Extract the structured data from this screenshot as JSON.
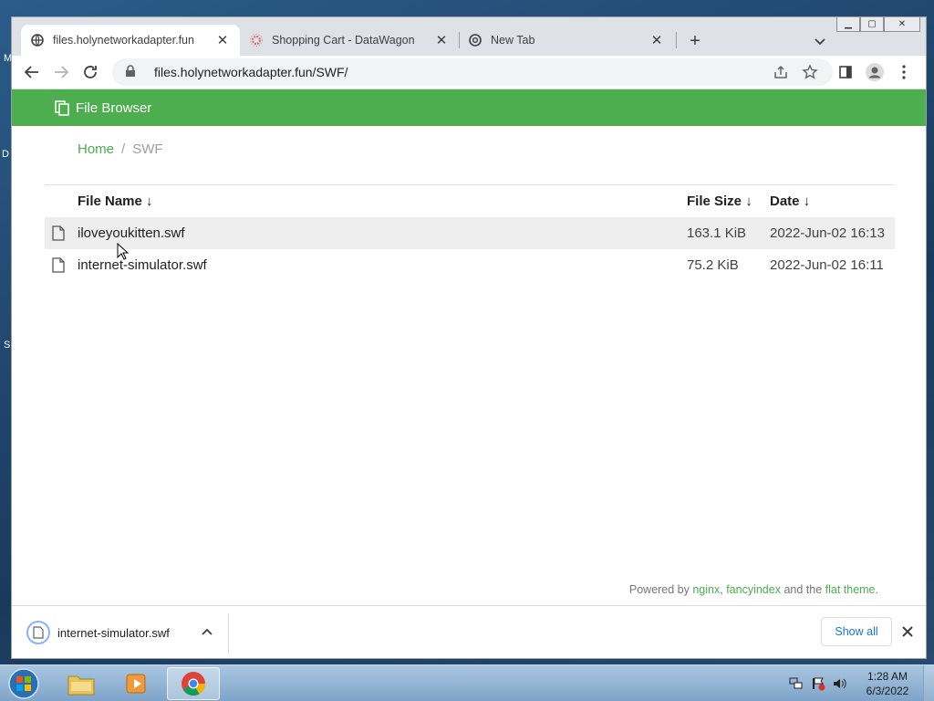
{
  "browser": {
    "tabs": [
      {
        "title": "files.holynetworkadapter.fun",
        "favicon": "globe-icon",
        "active": true
      },
      {
        "title": "Shopping Cart - DataWagon",
        "favicon": "datawagon-icon",
        "active": false
      },
      {
        "title": "New Tab",
        "favicon": "chrome-icon",
        "active": false
      }
    ],
    "new_tab_label": "+",
    "address": "files.holynetworkadapter.fun/SWF/"
  },
  "page": {
    "header_title": "File Browser",
    "breadcrumb": {
      "home": "Home",
      "separator": "/",
      "current": "SWF"
    },
    "columns": {
      "name": "File Name ↓",
      "size": "File Size ↓",
      "date": "Date ↓"
    },
    "files": [
      {
        "name": "iloveyoukitten.swf",
        "size": "163.1 KiB",
        "date": "2022-Jun-02 16:13"
      },
      {
        "name": "internet-simulator.swf",
        "size": "75.2 KiB",
        "date": "2022-Jun-02 16:11"
      }
    ],
    "footer": {
      "prefix": "Powered by ",
      "nginx": "nginx",
      "comma": ", ",
      "fancyindex": "fancyindex",
      "middle": " and the ",
      "theme": "flat theme",
      "suffix": "."
    }
  },
  "download_shelf": {
    "filename": "internet-simulator.swf",
    "show_all": "Show all"
  },
  "taskbar": {
    "time": "1:28 AM",
    "date": "6/3/2022"
  },
  "colors": {
    "accent_green": "#4cae4f",
    "link_blue": "#1a73e8"
  }
}
